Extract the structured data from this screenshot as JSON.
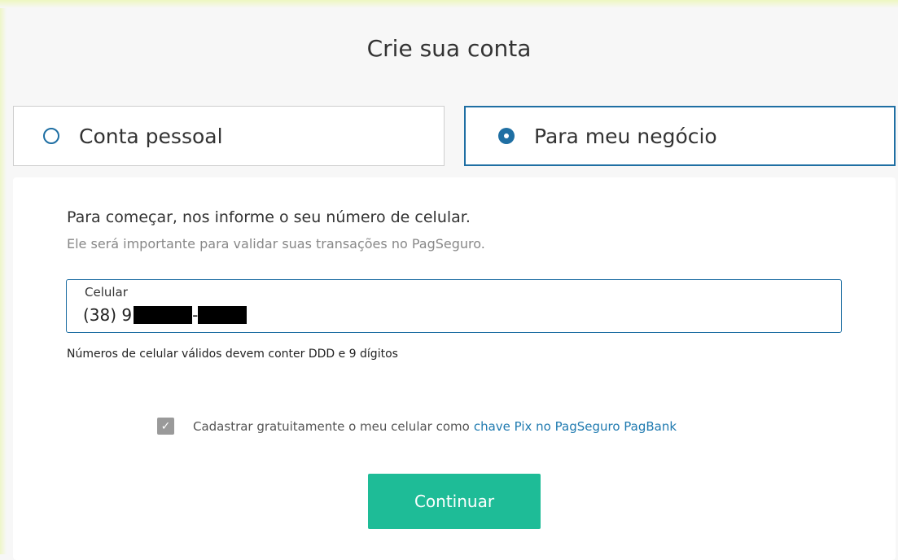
{
  "page": {
    "title": "Crie sua conta"
  },
  "account_type": {
    "options": [
      {
        "label": "Conta pessoal",
        "selected": false
      },
      {
        "label": "Para meu negócio",
        "selected": true
      }
    ]
  },
  "form": {
    "intro": "Para começar, nos informe o seu número de celular.",
    "intro_sub": "Ele será importante para validar suas transações no PagSeguro.",
    "phone": {
      "label": "Celular",
      "value_prefix": "(38) 9",
      "separator": "-",
      "hint": "Números de celular válidos devem conter DDD e 9 dígitos"
    },
    "pix": {
      "checked": true,
      "text": "Cadastrar gratuitamente o meu celular como",
      "link": "chave Pix no PagSeguro PagBank"
    },
    "submit_label": "Continuar"
  },
  "colors": {
    "primary_blue": "#1f6fa3",
    "button_green": "#1ebc97",
    "link_blue": "#1f7ab0"
  }
}
